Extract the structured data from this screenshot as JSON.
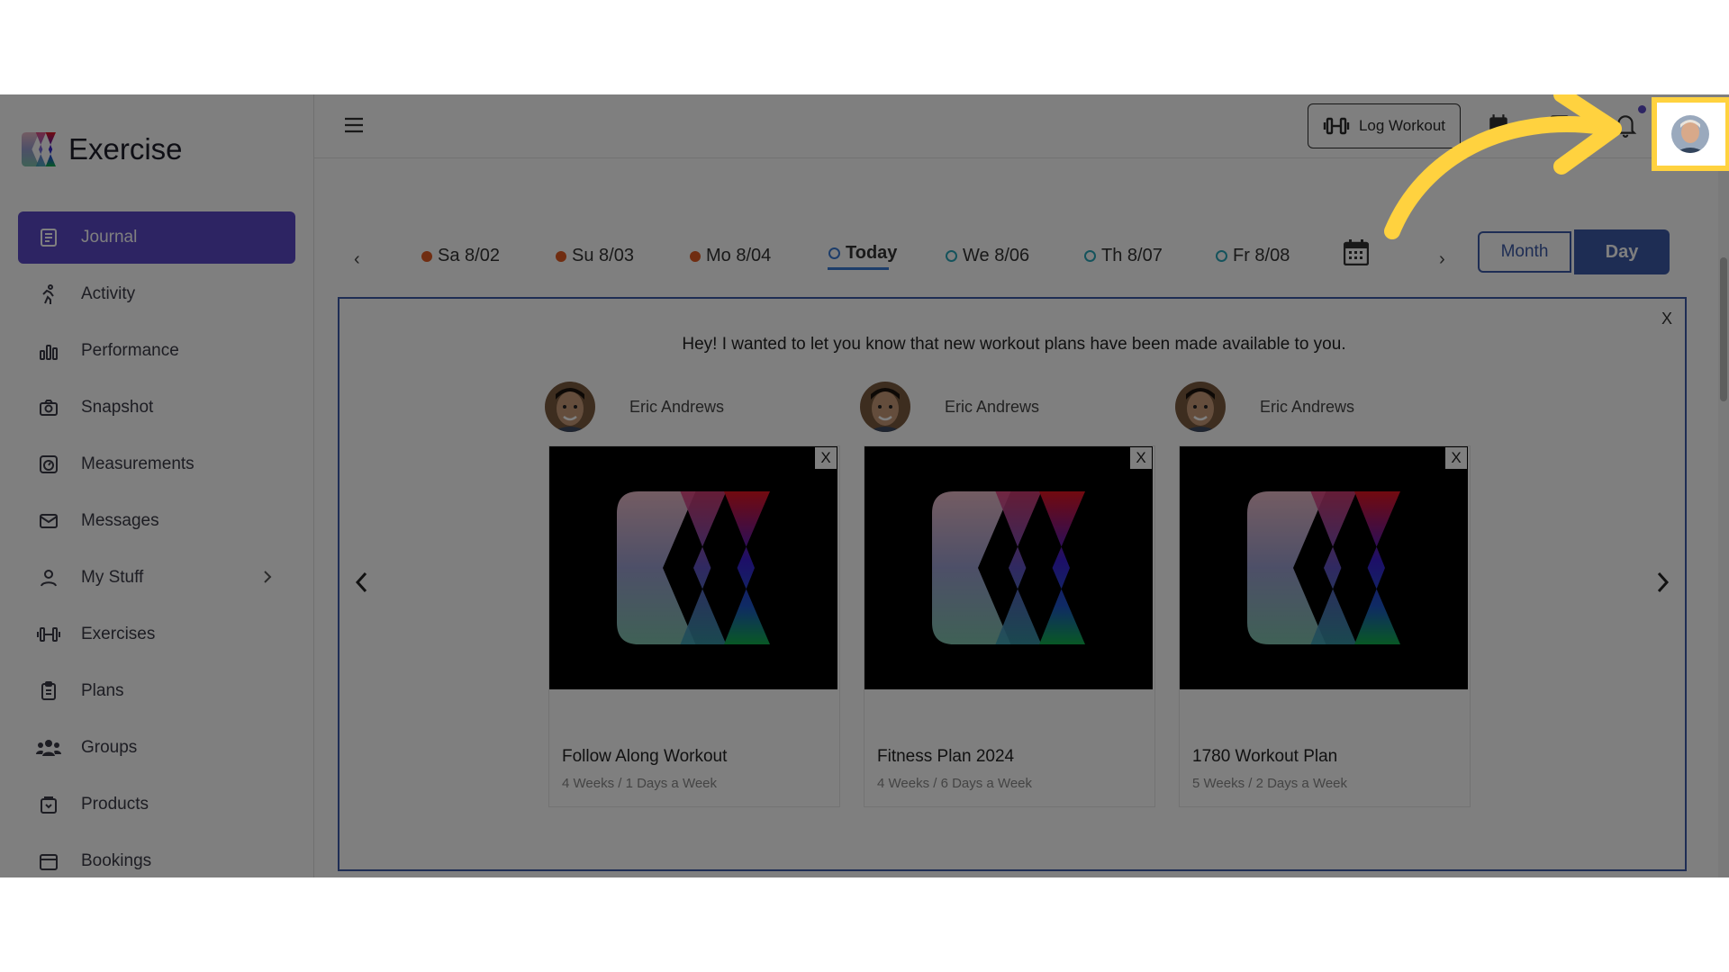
{
  "app": {
    "name": "Exercise"
  },
  "sidebar": {
    "items": [
      {
        "label": "Journal",
        "icon": "journal-icon",
        "active": true
      },
      {
        "label": "Activity",
        "icon": "running-icon"
      },
      {
        "label": "Performance",
        "icon": "bar-chart-icon"
      },
      {
        "label": "Snapshot",
        "icon": "camera-icon"
      },
      {
        "label": "Measurements",
        "icon": "measurements-icon"
      },
      {
        "label": "Messages",
        "icon": "mail-icon"
      },
      {
        "label": "My Stuff",
        "icon": "user-icon",
        "expandable": true
      },
      {
        "label": "Exercises",
        "icon": "dumbbell-icon"
      },
      {
        "label": "Plans",
        "icon": "clipboard-icon"
      },
      {
        "label": "Groups",
        "icon": "group-icon"
      },
      {
        "label": "Products",
        "icon": "product-icon"
      },
      {
        "label": "Bookings",
        "icon": "booking-icon"
      }
    ]
  },
  "topbar": {
    "log_workout_label": "Log Workout",
    "icons": [
      "menu-icon",
      "calendar-icon",
      "chat-icon",
      "bell-icon",
      "avatar"
    ]
  },
  "dates": {
    "days": [
      {
        "label": "Sa 8/02",
        "status": "filled"
      },
      {
        "label": "Su 8/03",
        "status": "filled"
      },
      {
        "label": "Mo 8/04",
        "status": "filled"
      },
      {
        "label": "Today",
        "status": "today"
      },
      {
        "label": "We 8/06",
        "status": "hollow"
      },
      {
        "label": "Th 8/07",
        "status": "hollow"
      },
      {
        "label": "Fr 8/08",
        "status": "hollow"
      }
    ],
    "view_month": "Month",
    "view_day": "Day",
    "active_view": "Day"
  },
  "message": {
    "close": "X",
    "text": "Hey! I wanted to let you know that new workout plans have been made available to you.",
    "cards": [
      {
        "author": "Eric Andrews",
        "title": "Follow Along Workout",
        "meta": "4 Weeks / 1 Days a Week",
        "close": "X"
      },
      {
        "author": "Eric Andrews",
        "title": "Fitness Plan 2024",
        "meta": "4 Weeks / 6 Days a Week",
        "close": "X"
      },
      {
        "author": "Eric Andrews",
        "title": "1780 Workout Plan",
        "meta": "5 Weeks / 2 Days a Week",
        "close": "X"
      }
    ]
  },
  "colors": {
    "accent": "#5b49c7",
    "primary": "#3c5aa8",
    "highlight": "#ffd23f",
    "past_dot": "#e15b22",
    "future_dot": "#2aa6b8"
  }
}
